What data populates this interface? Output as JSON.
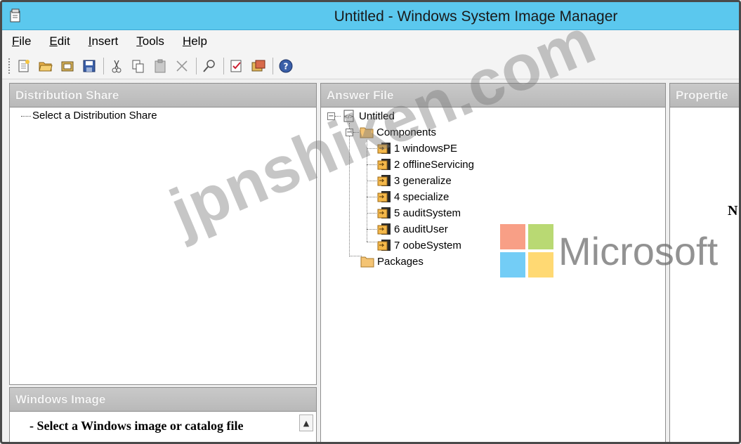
{
  "window": {
    "title": "Untitled - Windows System Image Manager"
  },
  "menu": [
    {
      "label": "File",
      "key": "F",
      "rest": "ile"
    },
    {
      "label": "Edit",
      "key": "E",
      "rest": "dit"
    },
    {
      "label": "Insert",
      "key": "I",
      "rest": "nsert"
    },
    {
      "label": "Tools",
      "key": "T",
      "rest": "ools"
    },
    {
      "label": "Help",
      "key": "H",
      "rest": "elp"
    }
  ],
  "toolbar": {
    "buttons": [
      "new-answer-file-icon",
      "open-answer-file-icon",
      "select-distribution-share-icon",
      "save-icon",
      "cut-icon",
      "copy-icon",
      "paste-icon",
      "delete-icon",
      "find-icon",
      "validate-icon",
      "create-configuration-set-icon",
      "help-icon"
    ]
  },
  "distribution_share": {
    "header": "Distribution Share",
    "item": "Select a Distribution Share"
  },
  "windows_image": {
    "header": "Windows Image",
    "item": "- Select a Windows image or catalog file"
  },
  "answer_file": {
    "header": "Answer File",
    "root": "Untitled",
    "components": "Components",
    "passes": [
      "1 windowsPE",
      "2 offlineServicing",
      "3 generalize",
      "4 specialize",
      "5 auditSystem",
      "6 auditUser",
      "7 oobeSystem"
    ],
    "packages": "Packages"
  },
  "properties": {
    "header": "Propertie",
    "partial_text": "N"
  },
  "watermark": {
    "text": "jpnshiken.com",
    "brand": "Microsoft",
    "logo_colors": [
      "#f25022",
      "#7fba00",
      "#00a4ef",
      "#ffb900"
    ]
  },
  "colors": {
    "titlebar": "#5bc8ee",
    "pane_header": "#c0c0c0"
  }
}
